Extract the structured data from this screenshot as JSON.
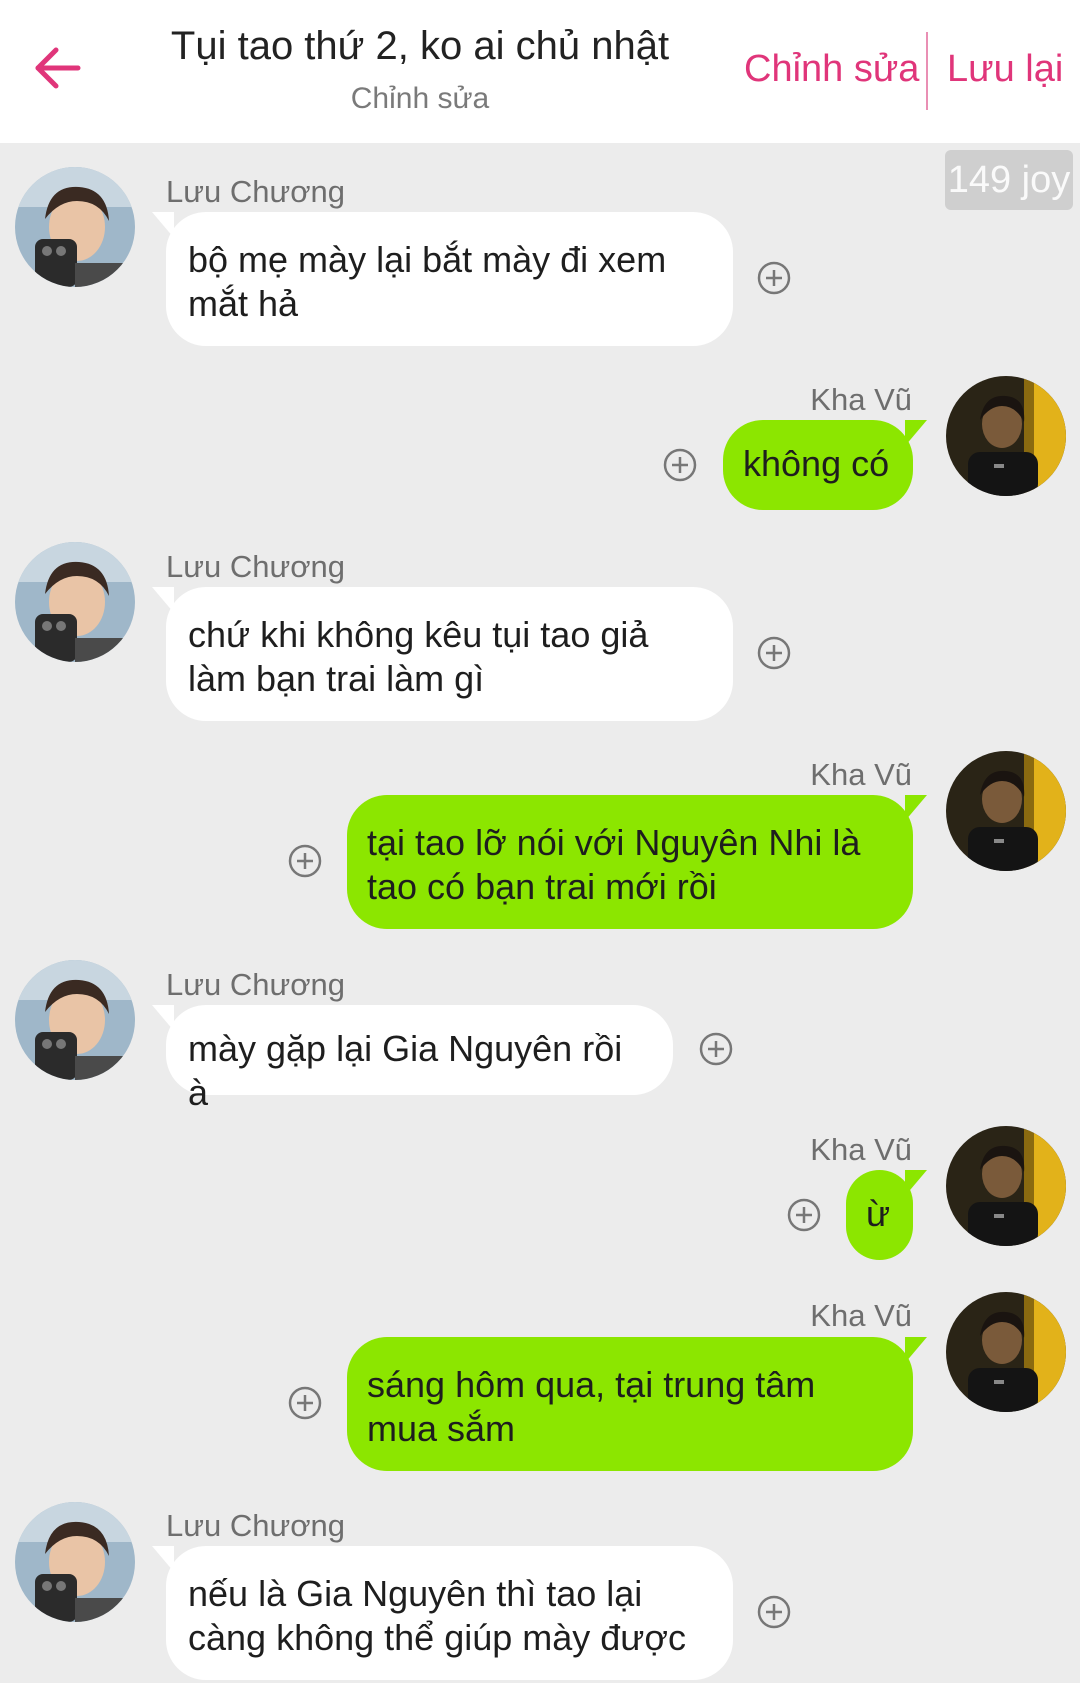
{
  "header": {
    "title": "Tụi tao thứ 2, ko ai chủ nhật",
    "subtitle": "Chỉnh sửa",
    "edit_label": "Chỉnh sửa",
    "save_label": "Lưu lại",
    "back_icon": "arrow-left-icon",
    "accent_color": "#e0357a"
  },
  "joy_badge": "149 joy",
  "participants": {
    "left_name": "Lưu Chương",
    "right_name": "Kha Vũ"
  },
  "bubble_colors": {
    "left": "#ffffff",
    "right": "#8ce600"
  },
  "messages": [
    {
      "sender": "Lưu Chương",
      "side": "left",
      "text": "bộ mẹ mày lại bắt mày đi xem mắt hả"
    },
    {
      "sender": "Kha Vũ",
      "side": "right",
      "text": "không có"
    },
    {
      "sender": "Lưu Chương",
      "side": "left",
      "text": "chứ khi không kêu tụi tao giả làm bạn trai làm gì"
    },
    {
      "sender": "Kha Vũ",
      "side": "right",
      "text": "tại tao lỡ nói với Nguyên Nhi là tao có bạn trai mới rồi"
    },
    {
      "sender": "Lưu Chương",
      "side": "left",
      "text": "mày gặp lại Gia Nguyên rồi à"
    },
    {
      "sender": "Kha Vũ",
      "side": "right",
      "text": "ừ"
    },
    {
      "sender": "Kha Vũ",
      "side": "right",
      "text": "sáng hôm qua, tại trung tâm mua sắm"
    },
    {
      "sender": "Lưu Chương",
      "side": "left",
      "text": "nếu là Gia Nguyên thì tao lại càng không thể giúp mày được"
    }
  ]
}
